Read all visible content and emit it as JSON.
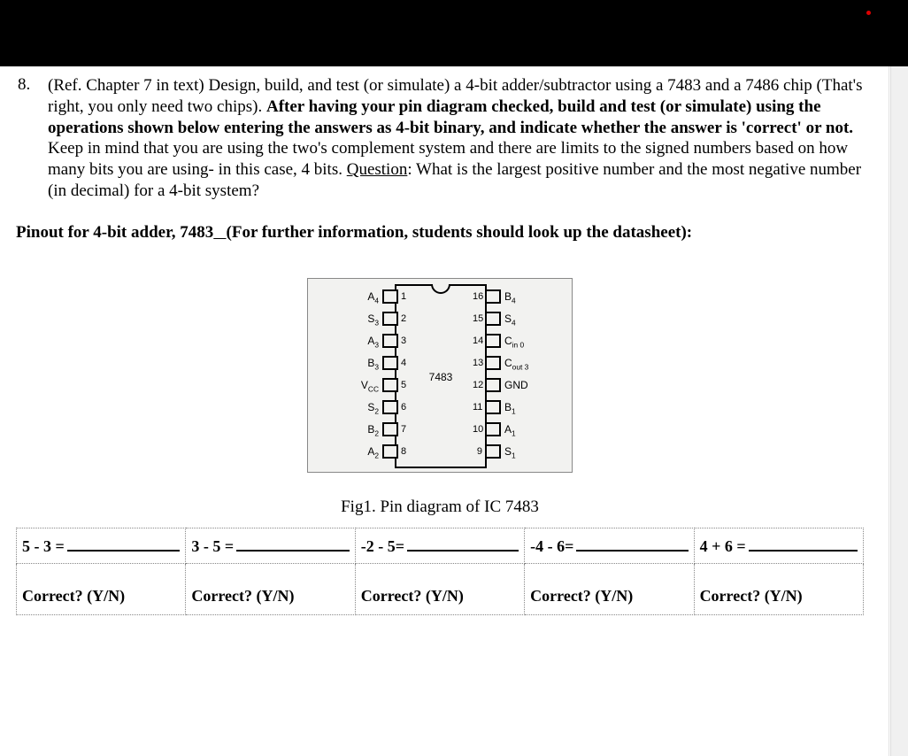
{
  "question": {
    "number": "8.",
    "text_parts": {
      "p1": "(Ref. Chapter 7 in text) Design, build, and test (or simulate) a 4-bit adder/subtractor using a 7483 and a 7486 chip (That's right, you only need two chips). ",
      "p2_bold": "After having your pin diagram checked, build and test (or simulate) using the operations shown below entering the answers as 4-bit binary, and indicate whether the answer is 'correct' or not.",
      "p3": " Keep in mind that you are using the two's complement system and there are limits to the signed numbers based on how many bits you are using- in this case, 4 bits. ",
      "p4_ul": "Question",
      "p5": ": What is the largest positive number and the most negative number (in decimal) for a 4-bit system?"
    }
  },
  "pinout_heading": {
    "a": "Pinout for 4-bit adder, 7483",
    "b": "(For further information, students should look up the datasheet):"
  },
  "ic": {
    "center": "7483",
    "left_pins": [
      {
        "label": "A",
        "sub": "4",
        "num": "1"
      },
      {
        "label": "S",
        "sub": "3",
        "num": "2"
      },
      {
        "label": "A",
        "sub": "3",
        "num": "3"
      },
      {
        "label": "B",
        "sub": "3",
        "num": "4"
      },
      {
        "label": "V",
        "sub": "CC",
        "num": "5"
      },
      {
        "label": "S",
        "sub": "2",
        "num": "6"
      },
      {
        "label": "B",
        "sub": "2",
        "num": "7"
      },
      {
        "label": "A",
        "sub": "2",
        "num": "8"
      }
    ],
    "right_pins": [
      {
        "num": "16",
        "label": "B",
        "sub": "4"
      },
      {
        "num": "15",
        "label": "S",
        "sub": "4"
      },
      {
        "num": "14",
        "label": "C",
        "sub": "in 0"
      },
      {
        "num": "13",
        "label": "C",
        "sub": "out 3"
      },
      {
        "num": "12",
        "label": "GND",
        "sub": ""
      },
      {
        "num": "11",
        "label": "B",
        "sub": "1"
      },
      {
        "num": "10",
        "label": "A",
        "sub": "1"
      },
      {
        "num": "9",
        "label": "S",
        "sub": "1"
      }
    ]
  },
  "fig_caption": "Fig1. Pin diagram of IC 7483",
  "operations": {
    "cells": [
      "5 - 3 =",
      "3 - 5 =",
      "-2 - 5=",
      "-4 - 6=",
      "4 + 6 ="
    ],
    "correct_label": "Correct? (Y/N)"
  }
}
